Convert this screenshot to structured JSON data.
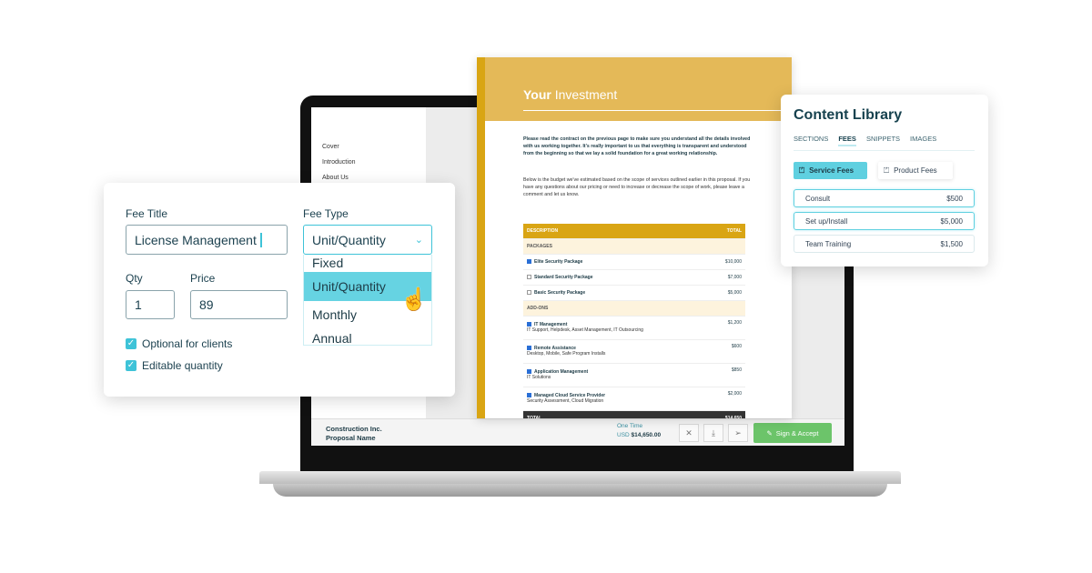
{
  "sidebar": {
    "items": [
      "Cover",
      "Introduction",
      "About Us"
    ]
  },
  "document": {
    "title_bold": "Your",
    "title_rest": "Investment",
    "para1": "Please read the contract on the previous page to make sure you understand all the details involved with us working together. It's really important to us that everything is transparent and understood from the beginning so that we lay a solid foundation for a great working relationship.",
    "para2": "Below is the budget we've estimated based on the scope of services outlined earlier in this proposal. If you have any questions about our pricing or need to increase or decrease the scope of work, please leave a comment and let us know.",
    "table": {
      "headers": [
        "DESCRIPTION",
        "TOTAL"
      ],
      "packages_label": "PACKAGES",
      "packages": [
        {
          "name": "Elite Security Package",
          "price": "$10,000",
          "checked": true
        },
        {
          "name": "Standard Security Package",
          "price": "$7,000",
          "checked": false
        },
        {
          "name": "Basic Security Package",
          "price": "$5,000",
          "checked": false
        }
      ],
      "addons_label": "ADD-ONS",
      "addons": [
        {
          "name": "IT Management",
          "desc": "IT Support, Helpdesk, Asset Management, IT Outsourcing",
          "price": "$1,200",
          "checked": true
        },
        {
          "name": "Remote Assistance",
          "desc": "Desktop, Mobile, Safe Program Installs",
          "price": "$600",
          "checked": true
        },
        {
          "name": "Application Management",
          "desc": "IT Solutions",
          "price": "$850",
          "checked": true
        },
        {
          "name": "Managed Cloud Service Provider",
          "desc": "Security Assessment, Cloud Migration",
          "price": "$2,000",
          "checked": true
        }
      ],
      "total_label": "TOTAL",
      "total": "$14,650"
    }
  },
  "bottombar": {
    "company": "Construction Inc.",
    "proposal": "Proposal Name",
    "term": "One Time",
    "currency": "USD",
    "amount": "$14,650.00",
    "sign_label": "Sign & Accept",
    "icons": [
      "close-icon",
      "download-icon",
      "send-icon"
    ]
  },
  "library": {
    "title": "Content Library",
    "tabs": [
      "SECTIONS",
      "FEES",
      "SNIPPETS",
      "IMAGES"
    ],
    "active_tab": "FEES",
    "folders": [
      "Service Fees",
      "Product Fees"
    ],
    "items": [
      {
        "name": "Consult",
        "price": "$500"
      },
      {
        "name": "Set up/Install",
        "price": "$5,000"
      },
      {
        "name": "Team Training",
        "price": "$1,500"
      }
    ]
  },
  "fee_form": {
    "title_label": "Fee Title",
    "title_value": "License Management",
    "type_label": "Fee Type",
    "type_value": "Unit/Quantity",
    "options": [
      "Fixed",
      "Unit/Quantity",
      "Monthly",
      "Annual"
    ],
    "qty_label": "Qty",
    "qty_value": "1",
    "price_label": "Price",
    "price_value": "89",
    "optional_label": "Optional for clients",
    "editable_label": "Editable quantity"
  },
  "colors": {
    "accent": "#3ec3d8",
    "gold": "#d9a514",
    "green": "#6cc46a"
  }
}
